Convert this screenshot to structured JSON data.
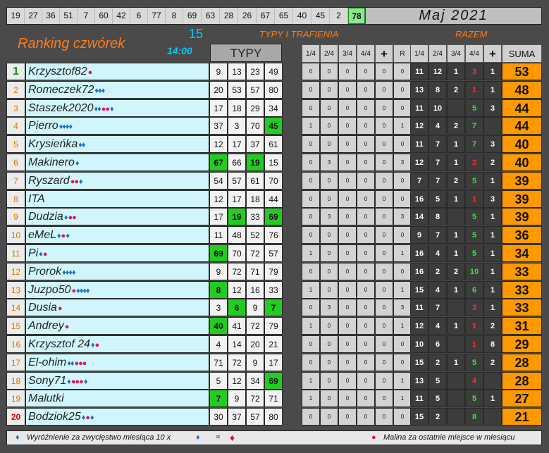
{
  "top_numbers": [
    "19",
    "27",
    "36",
    "51",
    "7",
    "60",
    "42",
    "6",
    "77",
    "8",
    "69",
    "63",
    "28",
    "26",
    "67",
    "65",
    "40",
    "45",
    "2",
    "78"
  ],
  "top_highlight_index": 19,
  "month": "Maj 2021",
  "title": "Ranking czwórek",
  "draw_number": "15",
  "draw_time": "14:00",
  "header_typy_trafienia": "TYPY I TRAFIENIA",
  "header_razem": "RAZEM",
  "header_typy": "TYPY",
  "sub_headers": [
    "1/4",
    "2/4",
    "3/4",
    "4/4",
    "+",
    "R",
    "1/4",
    "2/4",
    "3/4",
    "4/4",
    "+",
    "SUMA"
  ],
  "colors": {
    "orange": "#ff9900",
    "green_hit": "#22cc22",
    "name_bg": "#d0f6fc",
    "accent": "#ff7a1a",
    "cyan": "#00ccff"
  },
  "rows": [
    {
      "rank": "1",
      "name": "Krzysztof82",
      "badges": [
        [
          "m",
          ""
        ]
      ],
      "typy": [
        "9",
        "13",
        "23",
        "49"
      ],
      "hits": [
        false,
        false,
        false,
        false
      ],
      "stats": [
        "0",
        "0",
        "0",
        "0",
        "0",
        "0"
      ],
      "r": [
        "11",
        "12",
        "1",
        "3",
        "1"
      ],
      "suma": "53"
    },
    {
      "rank": "2",
      "name": "Romeczek72",
      "badges": [
        [
          "d",
          "♦♦♦"
        ]
      ],
      "typy": [
        "20",
        "53",
        "57",
        "80"
      ],
      "hits": [
        false,
        false,
        false,
        false
      ],
      "stats": [
        "0",
        "0",
        "0",
        "0",
        "0",
        "0"
      ],
      "r": [
        "13",
        "8",
        "2",
        "1",
        "1"
      ],
      "suma": "48"
    },
    {
      "rank": "3",
      "name": "Staszek2020",
      "badges": [
        [
          "d",
          "♦♦"
        ],
        [
          "m",
          "●●"
        ],
        [
          "d",
          "♦"
        ]
      ],
      "typy": [
        "17",
        "18",
        "29",
        "34"
      ],
      "hits": [
        false,
        false,
        false,
        false
      ],
      "stats": [
        "0",
        "0",
        "0",
        "0",
        "0",
        "0"
      ],
      "r": [
        "11",
        "10",
        "",
        "5",
        "3"
      ],
      "suma": "44"
    },
    {
      "rank": "4",
      "name": "Pierro",
      "badges": [
        [
          "d",
          "♦♦♦♦"
        ]
      ],
      "typy": [
        "37",
        "3",
        "70",
        "45"
      ],
      "hits": [
        false,
        false,
        false,
        true
      ],
      "stats": [
        "1",
        "0",
        "0",
        "0",
        "0",
        "1"
      ],
      "r": [
        "12",
        "4",
        "2",
        "7",
        ""
      ],
      "suma": "44"
    },
    {
      "rank": "5",
      "name": "Krysieńka",
      "badges": [
        [
          "d",
          "♦♦"
        ]
      ],
      "typy": [
        "12",
        "17",
        "37",
        "61"
      ],
      "hits": [
        false,
        false,
        false,
        false
      ],
      "stats": [
        "0",
        "0",
        "0",
        "0",
        "0",
        "0"
      ],
      "r": [
        "11",
        "7",
        "1",
        "7",
        "3"
      ],
      "suma": "40"
    },
    {
      "rank": "6",
      "name": "Makinero",
      "badges": [
        [
          "d",
          "♦"
        ]
      ],
      "typy": [
        "67",
        "66",
        "19",
        "15"
      ],
      "hits": [
        true,
        false,
        true,
        false
      ],
      "stats": [
        "0",
        "3",
        "0",
        "0",
        "0",
        "3"
      ],
      "r": [
        "12",
        "7",
        "1",
        "2",
        "2"
      ],
      "suma": "40"
    },
    {
      "rank": "7",
      "name": "Ryszard",
      "badges": [
        [
          "m",
          "●●"
        ],
        [
          "d",
          "♦"
        ]
      ],
      "typy": [
        "54",
        "57",
        "61",
        "70"
      ],
      "hits": [
        false,
        false,
        false,
        false
      ],
      "stats": [
        "0",
        "0",
        "0",
        "0",
        "0",
        "0"
      ],
      "r": [
        "7",
        "7",
        "2",
        "5",
        "1"
      ],
      "suma": "39"
    },
    {
      "rank": "8",
      "name": "ITA",
      "badges": [],
      "typy": [
        "12",
        "17",
        "18",
        "44"
      ],
      "hits": [
        false,
        false,
        false,
        false
      ],
      "stats": [
        "0",
        "0",
        "0",
        "0",
        "0",
        "0"
      ],
      "r": [
        "16",
        "5",
        "1",
        "1",
        "3"
      ],
      "suma": "39"
    },
    {
      "rank": "9",
      "name": "Dudzia",
      "badges": [
        [
          "d",
          "♦"
        ],
        [
          "m",
          "●●"
        ]
      ],
      "typy": [
        "17",
        "19",
        "33",
        "69"
      ],
      "hits": [
        false,
        true,
        false,
        true
      ],
      "stats": [
        "0",
        "3",
        "0",
        "0",
        "0",
        "3"
      ],
      "r": [
        "14",
        "8",
        "",
        "5",
        "1"
      ],
      "suma": "39"
    },
    {
      "rank": "10",
      "name": "eMeL",
      "badges": [
        [
          "d",
          "♦"
        ],
        [
          "m",
          "●"
        ],
        [
          "d",
          "♦"
        ]
      ],
      "typy": [
        "11",
        "48",
        "52",
        "76"
      ],
      "hits": [
        false,
        false,
        false,
        false
      ],
      "stats": [
        "0",
        "0",
        "0",
        "0",
        "0",
        "0"
      ],
      "r": [
        "9",
        "7",
        "1",
        "5",
        "1"
      ],
      "suma": "36"
    },
    {
      "rank": "11",
      "name": "Pi",
      "badges": [
        [
          "d",
          "♦"
        ],
        [
          "m",
          "●"
        ]
      ],
      "typy": [
        "69",
        "70",
        "72",
        "57"
      ],
      "hits": [
        true,
        false,
        false,
        false
      ],
      "stats": [
        "1",
        "0",
        "0",
        "0",
        "0",
        "1"
      ],
      "r": [
        "16",
        "4",
        "1",
        "5",
        "1"
      ],
      "suma": "34"
    },
    {
      "rank": "12",
      "name": "Prorok",
      "badges": [
        [
          "d",
          "♦♦♦♦"
        ]
      ],
      "typy": [
        "9",
        "72",
        "71",
        "79"
      ],
      "hits": [
        false,
        false,
        false,
        false
      ],
      "stats": [
        "0",
        "0",
        "0",
        "0",
        "0",
        "0"
      ],
      "r": [
        "16",
        "2",
        "2",
        "10",
        "1"
      ],
      "suma": "33"
    },
    {
      "rank": "13",
      "name": "Juzpo50",
      "badges": [
        [
          "m",
          "●"
        ],
        [
          "d",
          "♦♦♦♦"
        ]
      ],
      "typy": [
        "8",
        "12",
        "16",
        "33"
      ],
      "hits": [
        true,
        false,
        false,
        false
      ],
      "stats": [
        "1",
        "0",
        "0",
        "0",
        "0",
        "1"
      ],
      "r": [
        "15",
        "4",
        "1",
        "6",
        "1"
      ],
      "suma": "33"
    },
    {
      "rank": "14",
      "name": "Dusia",
      "badges": [
        [
          "m",
          "●"
        ]
      ],
      "typy": [
        "3",
        "6",
        "9",
        "7"
      ],
      "hits": [
        false,
        true,
        false,
        true
      ],
      "stats": [
        "0",
        "3",
        "0",
        "0",
        "0",
        "3"
      ],
      "r": [
        "11",
        "7",
        "",
        "3",
        "1"
      ],
      "suma": "33"
    },
    {
      "rank": "15",
      "name": "Andrey",
      "badges": [
        [
          "m",
          "●"
        ]
      ],
      "typy": [
        "40",
        "41",
        "72",
        "79"
      ],
      "hits": [
        true,
        false,
        false,
        false
      ],
      "stats": [
        "1",
        "0",
        "0",
        "0",
        "0",
        "1"
      ],
      "r": [
        "12",
        "4",
        "1",
        "1",
        "2"
      ],
      "suma": "31"
    },
    {
      "rank": "16",
      "name": "Krzysztof 24",
      "badges": [
        [
          "d",
          "♦"
        ],
        [
          "m",
          "●"
        ]
      ],
      "typy": [
        "4",
        "14",
        "20",
        "21"
      ],
      "hits": [
        false,
        false,
        false,
        false
      ],
      "stats": [
        "0",
        "0",
        "0",
        "0",
        "0",
        "0"
      ],
      "r": [
        "10",
        "6",
        "",
        "1",
        "8"
      ],
      "suma": "29"
    },
    {
      "rank": "17",
      "name": "El-ohim",
      "badges": [
        [
          "d",
          "♦♦"
        ],
        [
          "m",
          "●●●"
        ]
      ],
      "typy": [
        "71",
        "72",
        "9",
        "17"
      ],
      "hits": [
        false,
        false,
        false,
        false
      ],
      "stats": [
        "0",
        "0",
        "0",
        "0",
        "0",
        "0"
      ],
      "r": [
        "15",
        "2",
        "1",
        "5",
        "2"
      ],
      "suma": "28"
    },
    {
      "rank": "18",
      "name": "Sony71",
      "badges": [
        [
          "d",
          "♦"
        ],
        [
          "m",
          "●●●"
        ],
        [
          "d",
          "♦"
        ]
      ],
      "typy": [
        "5",
        "12",
        "34",
        "69"
      ],
      "hits": [
        false,
        false,
        false,
        true
      ],
      "stats": [
        "1",
        "0",
        "0",
        "0",
        "0",
        "1"
      ],
      "r": [
        "13",
        "5",
        "",
        "4",
        ""
      ],
      "suma": "28"
    },
    {
      "rank": "19",
      "name": "Malutki",
      "badges": [],
      "typy": [
        "7",
        "9",
        "72",
        "71"
      ],
      "hits": [
        true,
        false,
        false,
        false
      ],
      "stats": [
        "1",
        "0",
        "0",
        "0",
        "0",
        "1"
      ],
      "r": [
        "11",
        "5",
        "",
        "5",
        "1"
      ],
      "suma": "27"
    },
    {
      "rank": "20",
      "name": "Bodziok25",
      "badges": [
        [
          "d",
          "♦"
        ],
        [
          "m",
          "●"
        ],
        [
          "d",
          "♦"
        ]
      ],
      "typy": [
        "30",
        "37",
        "57",
        "80"
      ],
      "hits": [
        false,
        false,
        false,
        false
      ],
      "stats": [
        "0",
        "0",
        "0",
        "0",
        "0",
        "0"
      ],
      "r": [
        "15",
        "2",
        "",
        "8",
        ""
      ],
      "suma": "21"
    }
  ],
  "legend_left": "Wyróżnienie za zwycięstwo miesiąca  10 x",
  "legend_eq": "=",
  "legend_right": "Malina za ostatnie miejsce w miesiącu"
}
